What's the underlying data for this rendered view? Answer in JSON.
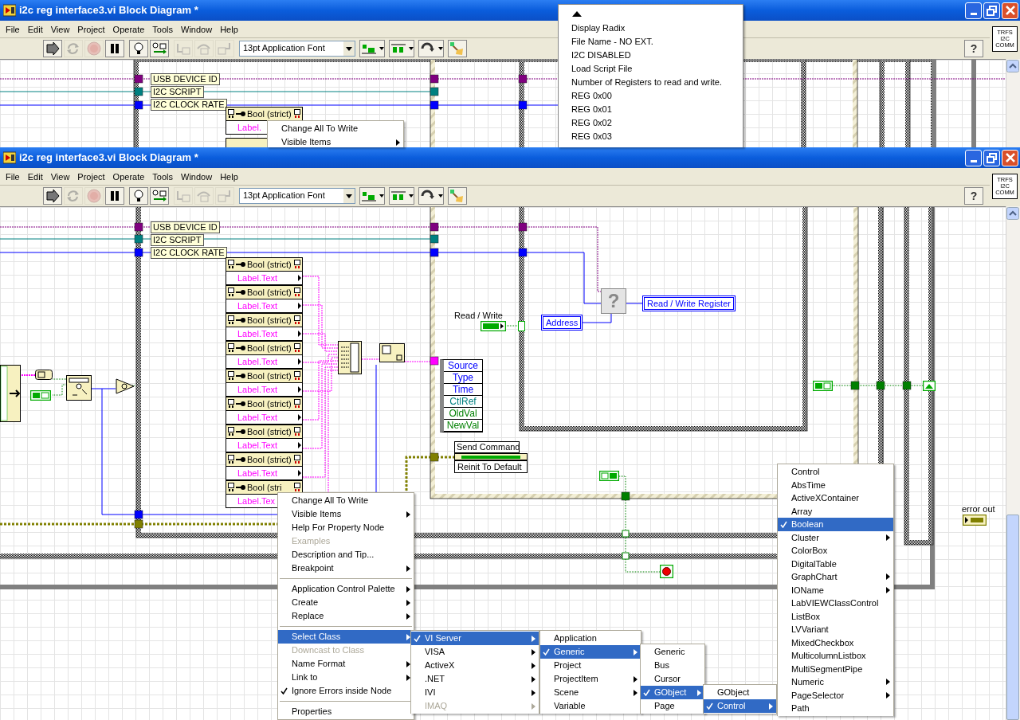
{
  "windows": [
    {
      "title": "i2c reg interface3.vi Block Diagram *",
      "menus": [
        "File",
        "Edit",
        "View",
        "Project",
        "Operate",
        "Tools",
        "Window",
        "Help"
      ],
      "toolbar": [
        {
          "kind": "run",
          "disabled": false
        },
        {
          "kind": "run_continuously",
          "disabled": true
        },
        {
          "kind": "abort",
          "disabled": true
        },
        {
          "kind": "pause",
          "disabled": false
        },
        {
          "kind": "highlight",
          "disabled": false
        },
        {
          "kind": "retain",
          "disabled": false
        },
        {
          "kind": "step_into",
          "disabled": true
        },
        {
          "kind": "step_over",
          "disabled": true
        },
        {
          "kind": "step_out",
          "disabled": true
        }
      ],
      "font": "13pt Application Font",
      "help": "?",
      "vi_icon": [
        "TRFS",
        "I2C",
        "COMM"
      ],
      "diagram": {
        "cluster_labels": [
          "USB DEVICE ID",
          "I2C SCRIPT",
          "I2C CLOCK RATE"
        ],
        "property_nodes": [
          {
            "class": "Bool (strict)",
            "property": "Label."
          }
        ],
        "context_menu": [
          {
            "kind": "item",
            "label": "Change All To Write",
            "selected": false,
            "checked": false,
            "disabled": false,
            "submenu": false
          },
          {
            "kind": "item",
            "label": "Visible Items",
            "selected": false,
            "checked": false,
            "disabled": false,
            "submenu": true
          }
        ]
      },
      "ring_list": [
        "Display Radix",
        "File Name - NO EXT.",
        "I2C DISABLED",
        "Load Script File",
        "Number of Registers to read and  write.",
        "REG 0x00",
        "REG 0x01",
        "REG 0x02",
        "REG 0x03"
      ]
    },
    {
      "title": "i2c reg interface3.vi Block Diagram *",
      "menus": [
        "File",
        "Edit",
        "View",
        "Project",
        "Operate",
        "Tools",
        "Window",
        "Help"
      ],
      "toolbar": [
        {
          "kind": "run",
          "disabled": false
        },
        {
          "kind": "run_continuously",
          "disabled": true
        },
        {
          "kind": "abort",
          "disabled": true
        },
        {
          "kind": "pause",
          "disabled": false
        },
        {
          "kind": "highlight",
          "disabled": false
        },
        {
          "kind": "retain",
          "disabled": false
        },
        {
          "kind": "step_into",
          "disabled": true
        },
        {
          "kind": "step_over",
          "disabled": true
        },
        {
          "kind": "step_out",
          "disabled": true
        }
      ],
      "font": "13pt Application Font",
      "help": "?",
      "vi_icon": [
        "TRFS",
        "I2C",
        "COMM"
      ],
      "diagram": {
        "cluster_labels": [
          "USB DEVICE ID",
          "I2C SCRIPT",
          "I2C CLOCK RATE"
        ],
        "property_nodes": [
          {
            "class": "Bool (strict)",
            "property": "Label.Text"
          },
          {
            "class": "Bool (strict)",
            "property": "Label.Text"
          },
          {
            "class": "Bool (strict)",
            "property": "Label.Text"
          },
          {
            "class": "Bool (strict)",
            "property": "Label.Text"
          },
          {
            "class": "Bool (strict)",
            "property": "Label.Text"
          },
          {
            "class": "Bool (strict)",
            "property": "Label.Text"
          },
          {
            "class": "Bool (strict)",
            "property": "Label.Text"
          },
          {
            "class": "Bool (strict)",
            "property": "Label.Text"
          },
          {
            "class": "Bool (stri",
            "property": "Label.Tex"
          }
        ],
        "read_write_label": "Read / Write",
        "address": "Address",
        "select_mark": "?",
        "register_indicator": "Read / Write Register",
        "event_data": [
          {
            "label": "Source",
            "color": "#0000ff"
          },
          {
            "label": "Type",
            "color": "#0000ff"
          },
          {
            "label": "Time",
            "color": "#0000ff"
          },
          {
            "label": "CtlRef",
            "color": "#008080"
          },
          {
            "label": "OldVal",
            "color": "#008000"
          },
          {
            "label": "NewVal",
            "color": "#008000"
          }
        ],
        "invoke_node": {
          "method": "Send Command",
          "parameter": "Reinit To Default"
        },
        "error_out": "error out",
        "context_menu": [
          {
            "kind": "item",
            "label": "Change All To Write",
            "selected": false,
            "checked": false,
            "disabled": false,
            "submenu": false
          },
          {
            "kind": "item",
            "label": "Visible Items",
            "selected": false,
            "checked": false,
            "disabled": false,
            "submenu": true
          },
          {
            "kind": "item",
            "label": "Help For Property Node",
            "selected": false,
            "checked": false,
            "disabled": false,
            "submenu": false
          },
          {
            "kind": "item",
            "label": "Examples",
            "selected": false,
            "checked": false,
            "disabled": true,
            "submenu": false
          },
          {
            "kind": "item",
            "label": "Description and Tip...",
            "selected": false,
            "checked": false,
            "disabled": false,
            "submenu": false
          },
          {
            "kind": "item",
            "label": "Breakpoint",
            "selected": false,
            "checked": false,
            "disabled": false,
            "submenu": true
          },
          {
            "kind": "separator"
          },
          {
            "kind": "item",
            "label": "Application Control Palette",
            "selected": false,
            "checked": false,
            "disabled": false,
            "submenu": true
          },
          {
            "kind": "item",
            "label": "Create",
            "selected": false,
            "checked": false,
            "disabled": false,
            "submenu": true
          },
          {
            "kind": "item",
            "label": "Replace",
            "selected": false,
            "checked": false,
            "disabled": false,
            "submenu": true
          },
          {
            "kind": "separator"
          },
          {
            "kind": "item",
            "label": "Select Class",
            "selected": true,
            "checked": false,
            "disabled": false,
            "submenu": true
          },
          {
            "kind": "item",
            "label": "Downcast to Class",
            "selected": false,
            "checked": false,
            "disabled": true,
            "submenu": false
          },
          {
            "kind": "item",
            "label": "Name Format",
            "selected": false,
            "checked": false,
            "disabled": false,
            "submenu": true
          },
          {
            "kind": "item",
            "label": "Link to",
            "selected": false,
            "checked": false,
            "disabled": false,
            "submenu": true
          },
          {
            "kind": "item",
            "label": "Ignore Errors inside Node",
            "selected": false,
            "checked": true,
            "disabled": false,
            "submenu": false
          },
          {
            "kind": "separator"
          },
          {
            "kind": "item",
            "label": "Properties",
            "selected": false,
            "checked": false,
            "disabled": false,
            "submenu": false
          }
        ],
        "submenus": [
          [
            {
              "kind": "item",
              "label": "VI Server",
              "selected": true,
              "checked": true,
              "disabled": false,
              "submenu": true
            },
            {
              "kind": "item",
              "label": "VISA",
              "selected": false,
              "checked": false,
              "disabled": false,
              "submenu": true
            },
            {
              "kind": "item",
              "label": "ActiveX",
              "selected": false,
              "checked": false,
              "disabled": false,
              "submenu": true
            },
            {
              "kind": "item",
              "label": ".NET",
              "selected": false,
              "checked": false,
              "disabled": false,
              "submenu": true
            },
            {
              "kind": "item",
              "label": "IVI",
              "selected": false,
              "checked": false,
              "disabled": false,
              "submenu": true
            },
            {
              "kind": "item",
              "label": "IMAQ",
              "selected": false,
              "checked": false,
              "disabled": true,
              "submenu": true
            }
          ],
          [
            {
              "kind": "item",
              "label": "Application",
              "selected": false,
              "checked": false,
              "disabled": false,
              "submenu": false
            },
            {
              "kind": "item",
              "label": "Generic",
              "selected": true,
              "checked": true,
              "disabled": false,
              "submenu": true
            },
            {
              "kind": "item",
              "label": "Project",
              "selected": false,
              "checked": false,
              "disabled": false,
              "submenu": false
            },
            {
              "kind": "item",
              "label": "ProjectItem",
              "selected": false,
              "checked": false,
              "disabled": false,
              "submenu": true
            },
            {
              "kind": "item",
              "label": "Scene",
              "selected": false,
              "checked": false,
              "disabled": false,
              "submenu": true
            },
            {
              "kind": "item",
              "label": "Variable",
              "selected": false,
              "checked": false,
              "disabled": false,
              "submenu": false
            }
          ],
          [
            {
              "kind": "item",
              "label": "Generic",
              "selected": false,
              "checked": false,
              "disabled": false,
              "submenu": false
            },
            {
              "kind": "item",
              "label": "Bus",
              "selected": false,
              "checked": false,
              "disabled": false,
              "submenu": false
            },
            {
              "kind": "item",
              "label": "Cursor",
              "selected": false,
              "checked": false,
              "disabled": false,
              "submenu": false
            },
            {
              "kind": "item",
              "label": "GObject",
              "selected": true,
              "checked": true,
              "disabled": false,
              "submenu": true
            },
            {
              "kind": "item",
              "label": "Page",
              "selected": false,
              "checked": false,
              "disabled": false,
              "submenu": false
            }
          ],
          [
            {
              "kind": "item",
              "label": "GObject",
              "selected": false,
              "checked": false,
              "disabled": false,
              "submenu": false
            },
            {
              "kind": "item",
              "label": "Control",
              "selected": true,
              "checked": true,
              "disabled": false,
              "submenu": true
            }
          ],
          [
            {
              "kind": "item",
              "label": "Control",
              "selected": false,
              "checked": false,
              "disabled": false,
              "submenu": false
            },
            {
              "kind": "item",
              "label": "AbsTime",
              "selected": false,
              "checked": false,
              "disabled": false,
              "submenu": false
            },
            {
              "kind": "item",
              "label": "ActiveXContainer",
              "selected": false,
              "checked": false,
              "disabled": false,
              "submenu": false
            },
            {
              "kind": "item",
              "label": "Array",
              "selected": false,
              "checked": false,
              "disabled": false,
              "submenu": false
            },
            {
              "kind": "item",
              "label": "Boolean",
              "selected": true,
              "checked": true,
              "disabled": false,
              "submenu": false
            },
            {
              "kind": "item",
              "label": "Cluster",
              "selected": false,
              "checked": false,
              "disabled": false,
              "submenu": true
            },
            {
              "kind": "item",
              "label": "ColorBox",
              "selected": false,
              "checked": false,
              "disabled": false,
              "submenu": false
            },
            {
              "kind": "item",
              "label": "DigitalTable",
              "selected": false,
              "checked": false,
              "disabled": false,
              "submenu": false
            },
            {
              "kind": "item",
              "label": "GraphChart",
              "selected": false,
              "checked": false,
              "disabled": false,
              "submenu": true
            },
            {
              "kind": "item",
              "label": "IOName",
              "selected": false,
              "checked": false,
              "disabled": false,
              "submenu": true
            },
            {
              "kind": "item",
              "label": "LabVIEWClassControl",
              "selected": false,
              "checked": false,
              "disabled": false,
              "submenu": false
            },
            {
              "kind": "item",
              "label": "ListBox",
              "selected": false,
              "checked": false,
              "disabled": false,
              "submenu": false
            },
            {
              "kind": "item",
              "label": "LVVariant",
              "selected": false,
              "checked": false,
              "disabled": false,
              "submenu": false
            },
            {
              "kind": "item",
              "label": "MixedCheckbox",
              "selected": false,
              "checked": false,
              "disabled": false,
              "submenu": false
            },
            {
              "kind": "item",
              "label": "MulticolumnListbox",
              "selected": false,
              "checked": false,
              "disabled": false,
              "submenu": false
            },
            {
              "kind": "item",
              "label": "MultiSegmentPipe",
              "selected": false,
              "checked": false,
              "disabled": false,
              "submenu": false
            },
            {
              "kind": "item",
              "label": "Numeric",
              "selected": false,
              "checked": false,
              "disabled": false,
              "submenu": true
            },
            {
              "kind": "item",
              "label": "PageSelector",
              "selected": false,
              "checked": false,
              "disabled": false,
              "submenu": true
            },
            {
              "kind": "item",
              "label": "Path",
              "selected": false,
              "checked": false,
              "disabled": false,
              "submenu": false
            }
          ]
        ]
      }
    }
  ]
}
